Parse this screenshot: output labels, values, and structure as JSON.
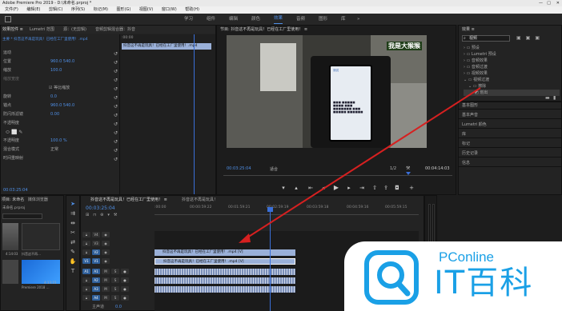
{
  "titlebar": {
    "title": "Adobe Premiere Pro 2019 - D:\\未命名.prproj *",
    "close": "✕",
    "maximize": "□",
    "minimize": "—"
  },
  "menubar": {
    "items": [
      "文件(F)",
      "编辑(E)",
      "剪辑(C)",
      "序列(S)",
      "标记(M)",
      "图形(G)",
      "视图(V)",
      "窗口(W)",
      "帮助(H)"
    ]
  },
  "workspaces": {
    "tabs": [
      "学习",
      "组件",
      "编辑",
      "颜色",
      "效果",
      "音频",
      "图形",
      "库"
    ],
    "active_index": 4,
    "more": "»"
  },
  "effect_controls": {
    "tabs": [
      "效果控件 ≡",
      "Lumetri 范围",
      "源：(无剪辑)",
      "音频剪辑混合器：抖音"
    ],
    "clip_label": "主要 * 抖音这不再是玩具！已经在工厂里使用！.mp4",
    "seq_label": "抖音这不再是玩具！已经在工厂里使用！.mp4",
    "timecode": ":00:00",
    "props": [
      {
        "name": "运动",
        "value": ""
      },
      {
        "name": "位置",
        "value": "960.0   540.0"
      },
      {
        "name": "缩放",
        "value": "100.0"
      },
      {
        "name": "缩放宽度",
        "value": ""
      },
      {
        "name": "",
        "value": "☑ 等比缩放"
      },
      {
        "name": "旋转",
        "value": "0.0"
      },
      {
        "name": "锚点",
        "value": "960.0   540.0"
      },
      {
        "name": "防闪烁滤镜",
        "value": "0.00"
      },
      {
        "name": "不透明度",
        "value": ""
      },
      {
        "name": "",
        "value": "⬭ ⬜ ✎"
      },
      {
        "name": "不透明度",
        "value": "100.0 %"
      },
      {
        "name": "混合模式",
        "value": "正常"
      },
      {
        "name": "时间重映射",
        "value": ""
      }
    ],
    "bottom_timecode": "00:03:25:04"
  },
  "program_monitor": {
    "title": "节目: 抖音这不再是玩具！已经在工厂里使用！ ≡",
    "overlay_text": "我是大猴猴",
    "timecode_left": "00:03:25:04",
    "fit_label": "适合",
    "fraction": "1/2",
    "timecode_right": "00:04:14:03",
    "phone": {
      "title": "测试",
      "lines": [
        "■■■ ■■■■■",
        "■■■■ ■■■",
        "■■■■■■■ ■■■",
        "■■■■■ ■■■■■■"
      ]
    }
  },
  "effects_panel": {
    "title": "效果 ≡",
    "search_value": "视频",
    "folders": [
      "预设",
      "Lumetri 预设",
      "音频效果",
      "音频过渡",
      "视频效果",
      "视频过渡"
    ],
    "sub_folder": "擦除",
    "sub_item": "划出",
    "sections": [
      "基本图形",
      "基本声音",
      "Lumetri 颜色",
      "库",
      "标记",
      "历史记录",
      "信息"
    ]
  },
  "project_panel": {
    "tabs": [
      "项目: 未命名",
      "媒体浏览器",
      "»"
    ],
    "file_label": "未命名.prproj",
    "items": [
      {
        "name": "抖音这不再…",
        "duration": "4:14:03"
      },
      {
        "name": "抖音这不再…",
        "duration": "4:14:03"
      },
      {
        "name": "Premiere 2018 …",
        "duration": "4:13:15"
      }
    ]
  },
  "timeline": {
    "tabs": [
      "抖音这不再是玩具！已经在工厂里使用！ ≡",
      "抖音这不再是玩具！"
    ],
    "timecode": "00:03:25:04",
    "ruler": [
      ":00:00",
      "00:00:59:22",
      "00:01:59:21",
      "00:02:59:19",
      "00:03:59:18",
      "00:04:59:16",
      "00:05:59:15"
    ],
    "tracks": [
      "V4",
      "V3",
      "V2",
      "V1",
      "A1",
      "A2",
      "A3",
      "A4"
    ],
    "master": "主声道",
    "master_value": "0.0",
    "clips": [
      {
        "track": "V2",
        "label": "抖音这不再是玩具！已经在工厂里使用！.mp4 [V]"
      },
      {
        "track": "V1",
        "label": "抖音这不再是玩具！已经在工厂里使用！.mp4 [V]"
      }
    ]
  },
  "watermark": {
    "brand": "PConline",
    "name": "IT百科"
  },
  "colors": {
    "accent": "#4f8fe6",
    "playhead": "#3a6fd8",
    "arrow": "#d62020",
    "clip": "#9ab0d8",
    "clip_audio": "#7b8fb8"
  }
}
